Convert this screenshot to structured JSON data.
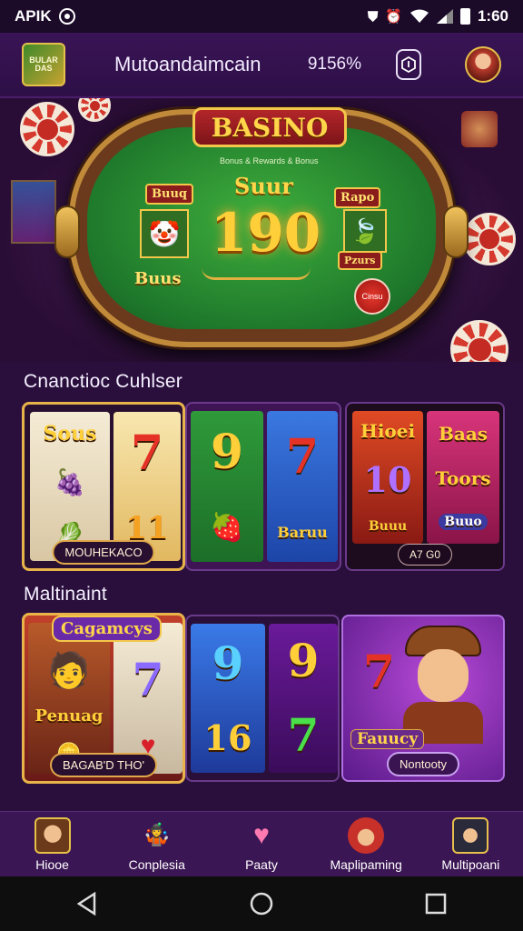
{
  "status_bar": {
    "left_text": "APIK",
    "time": "1:60"
  },
  "header": {
    "title": "Mutoandaimcain",
    "balance": "9156%",
    "logo_text": "BULAR DAS"
  },
  "hero": {
    "badge": "BASINO",
    "subtitle": "Bonus & Rewards & Bonus",
    "bonus_label": "Suur",
    "jackpot": "190",
    "tags": [
      "Buuq",
      "Rapo",
      "Buus",
      "Pzurs",
      "Cinsu"
    ]
  },
  "section1": {
    "title": "Cnanctioc Cuhlser",
    "cards": [
      {
        "symbols": [
          "Sous",
          "7",
          "11"
        ],
        "pill": "MOUHEKACO"
      },
      {
        "symbols": [
          "9",
          "7",
          "Baruu"
        ],
        "pill": ""
      },
      {
        "symbols": [
          "Hioei",
          "10",
          "Buuu",
          "Baas",
          "Toors",
          "Buuo"
        ],
        "pill": "A7 G0"
      }
    ]
  },
  "section2": {
    "title": "Maltinaint",
    "cards": [
      {
        "badge": "Cagamcys",
        "symbols": [
          "7",
          "Penuag"
        ],
        "pill": "BAGAB'D THO'"
      },
      {
        "symbols": [
          "9",
          "16",
          "9",
          "7"
        ],
        "pill": ""
      },
      {
        "symbols": [
          "7",
          "Fauucy"
        ],
        "pill": "Nontooty"
      }
    ]
  },
  "bottom_nav": [
    {
      "label": "Hiooe",
      "icon": "home-avatar-icon"
    },
    {
      "label": "Conplesia",
      "icon": "joker-icon"
    },
    {
      "label": "Paaty",
      "icon": "heart-icon"
    },
    {
      "label": "Maplipaming",
      "icon": "player-icon"
    },
    {
      "label": "Multipoani",
      "icon": "multiplayer-icon"
    }
  ],
  "colors": {
    "background": "#2a0f3d",
    "gold": "#e8b44a",
    "felt": "#1f7a2c"
  }
}
